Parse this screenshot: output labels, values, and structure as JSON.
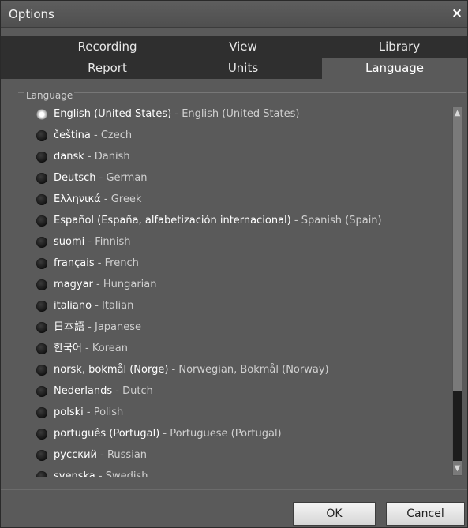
{
  "window": {
    "title": "Options",
    "close_symbol": "×"
  },
  "tabs": {
    "row1": [
      {
        "label": "Recording"
      },
      {
        "label": "View"
      },
      {
        "label": "Library"
      }
    ],
    "row2": [
      {
        "label": "Report"
      },
      {
        "label": "Units"
      },
      {
        "label": "Language"
      }
    ],
    "active": "Language"
  },
  "group": {
    "label": "Language"
  },
  "languages": [
    {
      "native": "English (United States)",
      "english": "English (United States)",
      "checked": true
    },
    {
      "native": "čeština",
      "english": "Czech"
    },
    {
      "native": "dansk",
      "english": "Danish"
    },
    {
      "native": "Deutsch",
      "english": "German"
    },
    {
      "native": "Ελληνικά",
      "english": "Greek"
    },
    {
      "native": "Español (España, alfabetización internacional)",
      "english": "Spanish (Spain)"
    },
    {
      "native": "suomi",
      "english": "Finnish"
    },
    {
      "native": "français",
      "english": "French"
    },
    {
      "native": "magyar",
      "english": "Hungarian"
    },
    {
      "native": "italiano",
      "english": "Italian"
    },
    {
      "native": "日本語",
      "english": "Japanese"
    },
    {
      "native": "한국어",
      "english": "Korean"
    },
    {
      "native": "norsk, bokmål (Norge)",
      "english": "Norwegian, Bokmål (Norway)"
    },
    {
      "native": "Nederlands",
      "english": "Dutch"
    },
    {
      "native": "polski",
      "english": "Polish"
    },
    {
      "native": "português (Portugal)",
      "english": "Portuguese (Portugal)"
    },
    {
      "native": "русский",
      "english": "Russian"
    },
    {
      "native": "svenska",
      "english": "Swedish"
    }
  ],
  "separator": " - ",
  "buttons": {
    "ok": "OK",
    "cancel": "Cancel"
  },
  "scroll": {
    "up_symbol": "▲",
    "down_symbol": "▼"
  }
}
